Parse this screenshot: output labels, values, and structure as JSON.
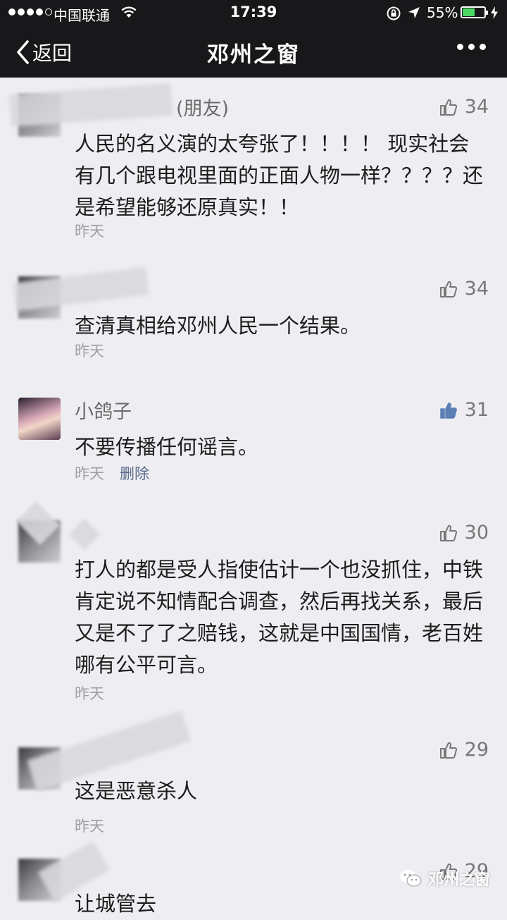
{
  "status": {
    "carrier": "中国联通",
    "time": "17:39",
    "battery_pct": "55%",
    "battery_level": 0.55,
    "signal_bars": 4
  },
  "nav": {
    "back_label": "返回",
    "title": "邓州之窗"
  },
  "comments": [
    {
      "name": "(朋友)",
      "likes": "34",
      "text": "人民的名义演的太夸张了！！！！ 现实社会有几个跟电视里面的正面人物一样？？？？还是希望能够还原真实！！",
      "time": "昨天"
    },
    {
      "name": "",
      "likes": "34",
      "text": "查清真相给邓州人民一个结果。",
      "time": "昨天"
    },
    {
      "name": "小鸽子",
      "likes": "31",
      "text": "不要传播任何谣言。",
      "time": "昨天",
      "delete": "删除",
      "liked": true
    },
    {
      "name": "",
      "likes": "30",
      "text": "打人的都是受人指使估计一个也没抓住，中铁肯定说不知情配合调查，然后再找关系，最后又是不了了之赔钱，这就是中国国情，老百姓哪有公平可言。",
      "time": "昨天"
    },
    {
      "name": "",
      "likes": "29",
      "text": "这是恶意杀人",
      "time": "昨天"
    },
    {
      "name": "",
      "likes": "29",
      "text": "让城管去",
      "time": ""
    }
  ],
  "watermark": "邓州之窗",
  "colors": {
    "bar_bg": "#18181a",
    "page_bg": "#eeeef2",
    "liked_thumb": "#5b7fb5",
    "delete_link": "#5b6b8c",
    "battery": "#4cd964"
  }
}
